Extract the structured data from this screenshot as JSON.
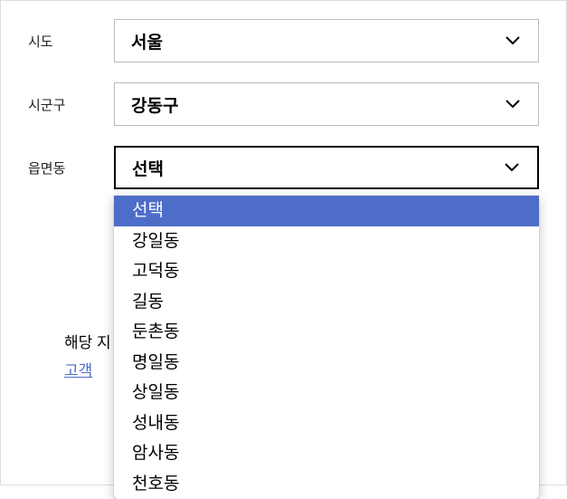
{
  "form": {
    "rows": [
      {
        "label": "시도",
        "value": "서울",
        "focused": false
      },
      {
        "label": "시군구",
        "value": "강동구",
        "focused": false
      },
      {
        "label": "읍면동",
        "value": "선택",
        "focused": true
      }
    ]
  },
  "dropdown": {
    "options": [
      {
        "label": "선택",
        "selected": true
      },
      {
        "label": "강일동",
        "selected": false
      },
      {
        "label": "고덕동",
        "selected": false
      },
      {
        "label": "길동",
        "selected": false
      },
      {
        "label": "둔촌동",
        "selected": false
      },
      {
        "label": "명일동",
        "selected": false
      },
      {
        "label": "상일동",
        "selected": false
      },
      {
        "label": "성내동",
        "selected": false
      },
      {
        "label": "암사동",
        "selected": false
      },
      {
        "label": "천호동",
        "selected": false
      }
    ]
  },
  "info": {
    "line1_prefix": "해당 지",
    "link_text": "고객"
  }
}
